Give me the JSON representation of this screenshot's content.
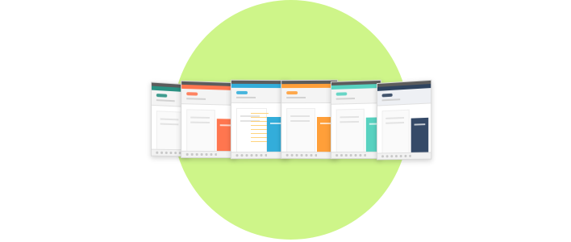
{
  "scene": {
    "background_color": "#ffffff",
    "circle_color": "#cef589"
  },
  "screens": [
    {
      "name": "screen-1",
      "accent": "#1f8c7c"
    },
    {
      "name": "screen-2",
      "accent": "#ff6f46"
    },
    {
      "name": "screen-3",
      "accent": "#28a9d8"
    },
    {
      "name": "screen-4",
      "accent": "#ff9a2e"
    },
    {
      "name": "screen-5",
      "accent": "#4fd0bd"
    },
    {
      "name": "screen-6",
      "accent": "#243a56"
    }
  ]
}
